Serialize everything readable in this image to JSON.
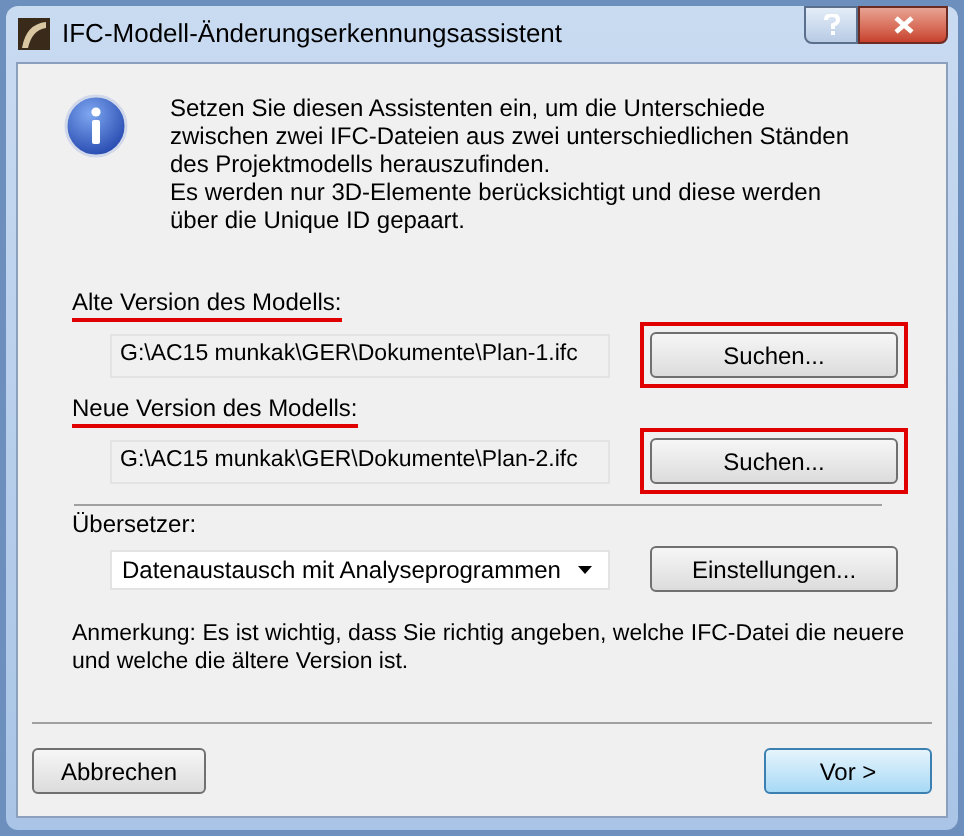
{
  "window": {
    "title": "IFC-Modell-Änderungserkennungsassistent"
  },
  "info": [
    "Setzen Sie diesen Assistenten ein, um die Unterschiede zwischen zwei IFC-Dateien aus zwei unterschiedlichen Ständen des Projektmodells herauszufinden.",
    "Es werden nur 3D-Elemente berücksichtigt und diese werden über die Unique ID gepaart."
  ],
  "files": [
    {
      "label": "Alte Version des Modells:",
      "path": "G:\\AC15 munkak\\GER\\Dokumente\\Plan-1.ifc",
      "button": "Suchen...",
      "highlighted": true
    },
    {
      "label": "Neue Version des Modells:",
      "path": "G:\\AC15 munkak\\GER\\Dokumente\\Plan-2.ifc",
      "button": "Suchen...",
      "highlighted": true
    }
  ],
  "translator": {
    "label": "Übersetzer:",
    "value": "Datenaustausch mit Analyseprogrammen",
    "button": "Einstellungen..."
  },
  "note": "Anmerkung: Es ist wichtig, dass Sie richtig angeben, welche IFC-Datei die neuere und welche die ältere Version ist.",
  "footer": {
    "cancel": "Abbrechen",
    "next": "Vor >"
  }
}
